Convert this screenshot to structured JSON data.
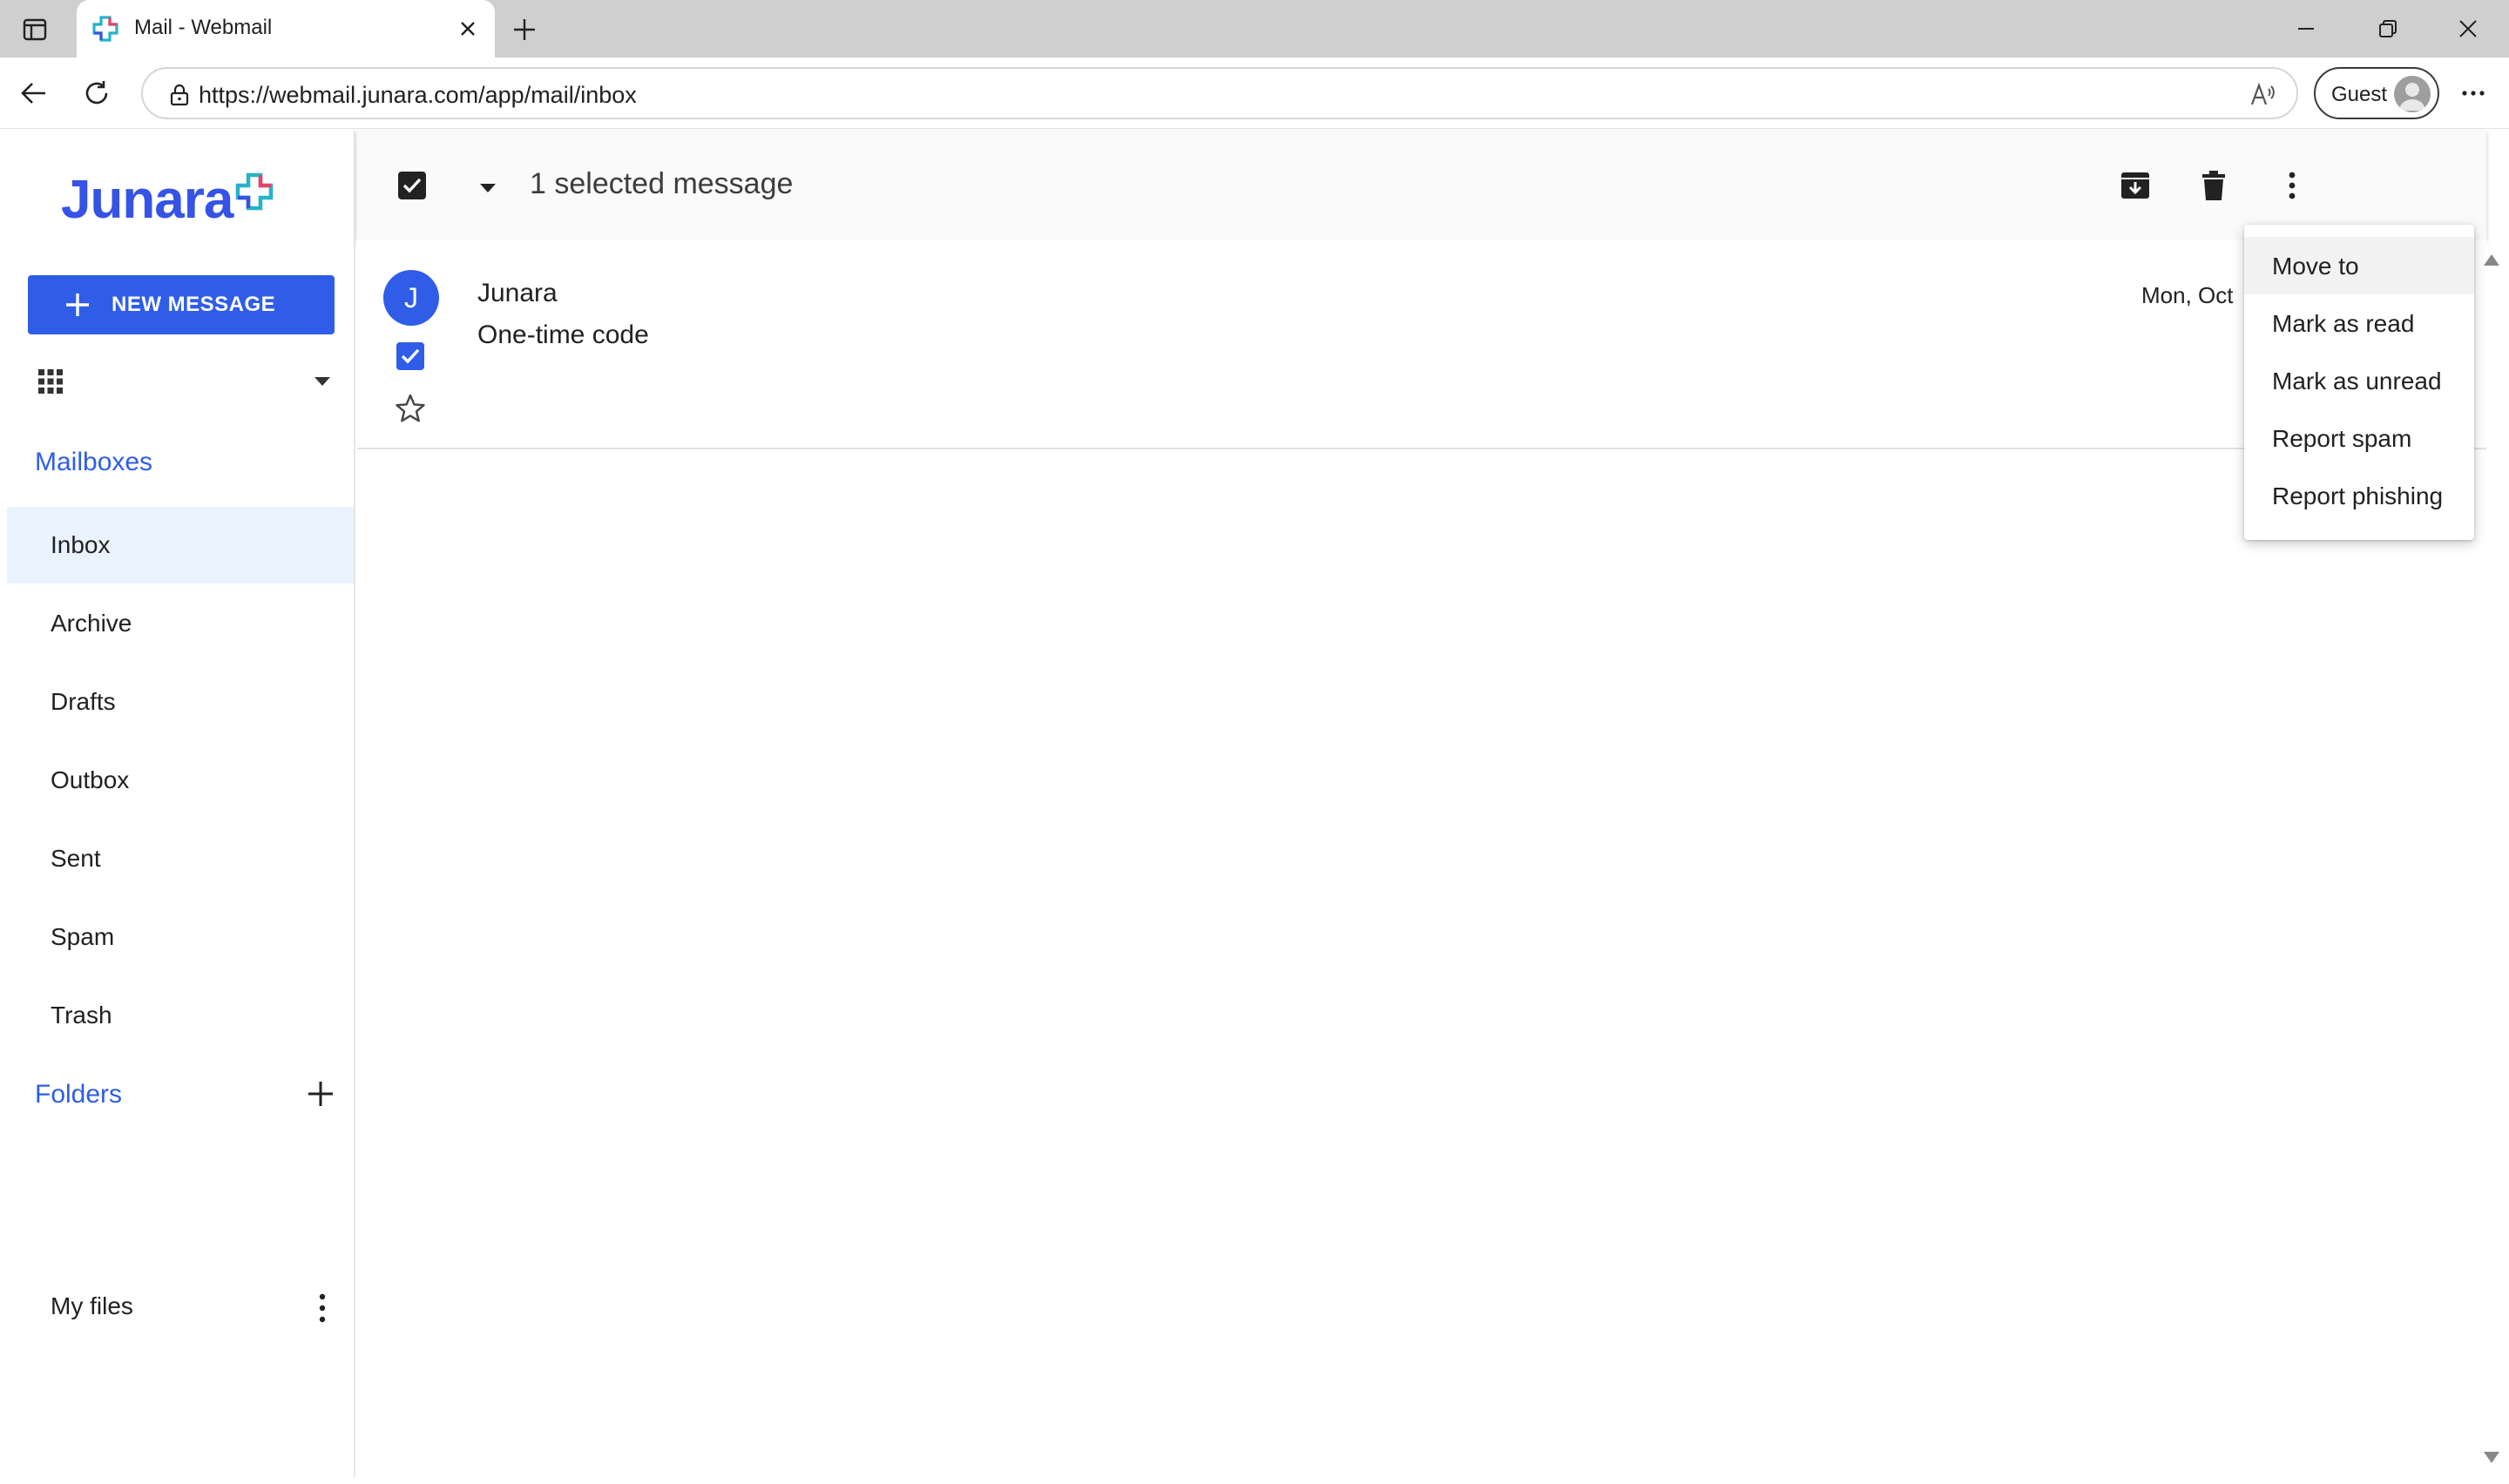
{
  "browser": {
    "tab_title": "Mail - Webmail",
    "url": "https://webmail.junara.com/app/mail/inbox",
    "profile_label": "Guest"
  },
  "app": {
    "logo_text": "Junara",
    "new_message_label": "NEW MESSAGE",
    "brand_color": "#2f5de8"
  },
  "sidebar": {
    "mailboxes_title": "Mailboxes",
    "mailboxes": [
      {
        "label": "Inbox",
        "active": true
      },
      {
        "label": "Archive"
      },
      {
        "label": "Drafts"
      },
      {
        "label": "Outbox"
      },
      {
        "label": "Sent"
      },
      {
        "label": "Spam"
      },
      {
        "label": "Trash"
      }
    ],
    "folders_title": "Folders",
    "folders": [
      {
        "label": "My files"
      }
    ]
  },
  "toolbar": {
    "selection_text": "1 selected message"
  },
  "messages": [
    {
      "avatar_initial": "J",
      "sender": "Junara",
      "subject": "One-time code",
      "date": "Mon, Oct",
      "selected": true,
      "starred": false
    }
  ],
  "context_menu": {
    "items": [
      {
        "label": "Move to",
        "highlighted": true
      },
      {
        "label": "Mark as read"
      },
      {
        "label": "Mark as unread"
      },
      {
        "label": "Report spam"
      },
      {
        "label": "Report phishing"
      }
    ]
  }
}
